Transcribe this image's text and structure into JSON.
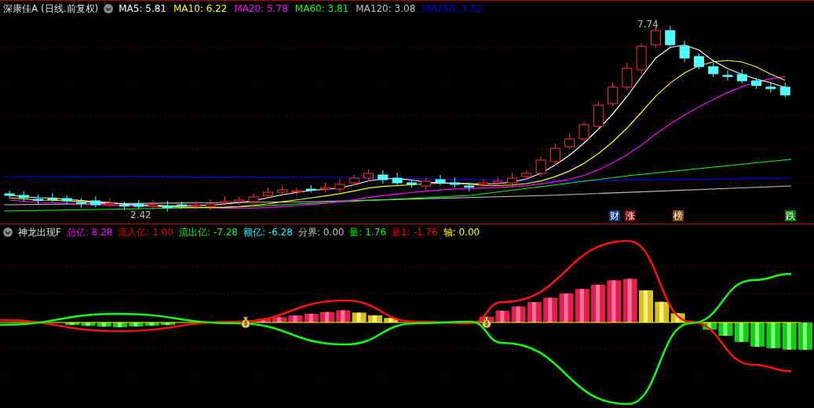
{
  "price_panel": {
    "stock_name": "深康佳A",
    "period": "(日线.前复权)",
    "moving_averages": [
      {
        "label": "MA5: 5.81",
        "color": "#ffffff"
      },
      {
        "label": "MA10: 6.22",
        "color": "#ffff00"
      },
      {
        "label": "MA20: 5.78",
        "color": "#ff00ff"
      },
      {
        "label": "MA60: 3.81",
        "color": "#00ff00"
      },
      {
        "label": "MA120: 3.08",
        "color": "#c0c0c0"
      },
      {
        "label": "MA250: 3.32",
        "color": "#0000ff"
      }
    ],
    "high_label": "7.74",
    "low_label": "2.42",
    "event_badges": [
      {
        "text": "财",
        "color": "#003a80"
      },
      {
        "text": "涨",
        "color": "#800000"
      },
      {
        "text": "榜",
        "color": "#804000"
      },
      {
        "text": "跌",
        "color": "#008000"
      }
    ]
  },
  "indicator_panel": {
    "name": "神龙出现F",
    "values": [
      {
        "label": "总亿: 8.28",
        "color": "#ff00ff"
      },
      {
        "label": "流入亿: 1.00",
        "color": "#ff0000"
      },
      {
        "label": "流出亿: -7.28",
        "color": "#00ff00"
      },
      {
        "label": "额亿: -6.28",
        "color": "#00ffff"
      },
      {
        "label": "分界: 0.00",
        "color": "#c0c0c0"
      },
      {
        "label": "量: 1.76",
        "color": "#00ff00"
      },
      {
        "label": "量1: -1.76",
        "color": "#ff0000"
      },
      {
        "label": "轴: 0.00",
        "color": "#ffff00"
      }
    ]
  }
}
